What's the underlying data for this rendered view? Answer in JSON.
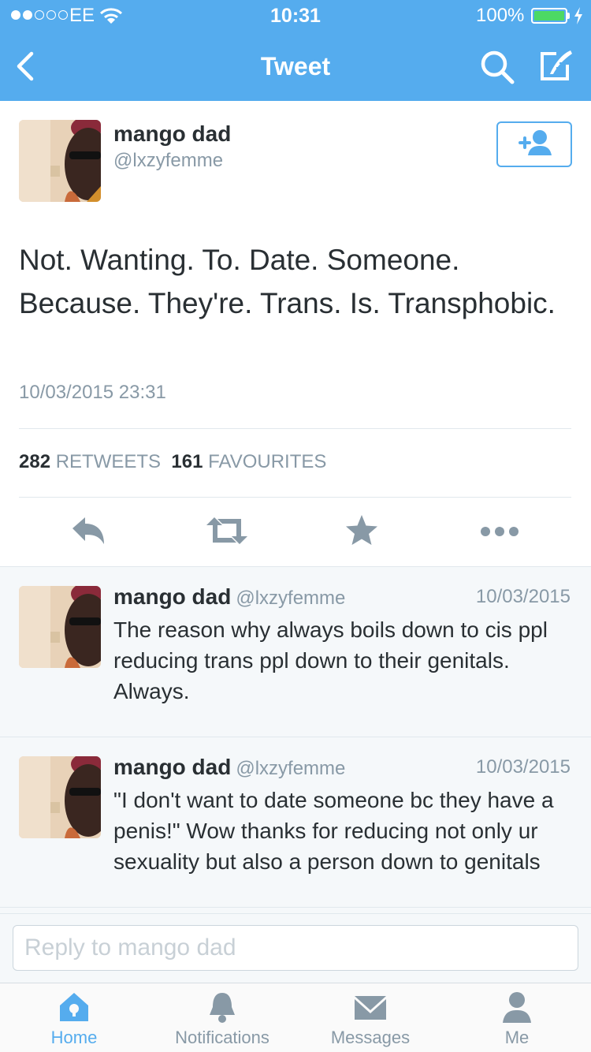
{
  "status_bar": {
    "carrier": "EE",
    "time": "10:31",
    "battery": "100%"
  },
  "nav": {
    "title": "Tweet"
  },
  "tweet": {
    "name": "mango dad",
    "handle": "@lxzyfemme",
    "text": "Not. Wanting. To. Date. Someone. Because. They're. Trans. Is. Transphobic.",
    "timestamp": "10/03/2015 23:31",
    "retweets_count": "282",
    "retweets_label": "RETWEETS",
    "favourites_count": "161",
    "favourites_label": "FAVOURITES"
  },
  "replies": [
    {
      "name": "mango dad",
      "handle": "@lxzyfemme",
      "date": "10/03/2015",
      "text": "The reason why always boils down to cis ppl reducing trans ppl down to their genitals. Always."
    },
    {
      "name": "mango dad",
      "handle": "@lxzyfemme",
      "date": "10/03/2015",
      "text": "\"I don't want to date someone bc they have a penis!\" Wow thanks for reducing not only ur sexuality but also a person down to genitals"
    }
  ],
  "reply_box": {
    "placeholder": "Reply to mango dad"
  },
  "tabs": [
    {
      "label": "Home",
      "icon": "home-icon",
      "active": true
    },
    {
      "label": "Notifications",
      "icon": "bell-icon",
      "active": false
    },
    {
      "label": "Messages",
      "icon": "envelope-icon",
      "active": false
    },
    {
      "label": "Me",
      "icon": "person-icon",
      "active": false
    }
  ],
  "colors": {
    "brand": "#55acee",
    "text": "#292f33",
    "muted": "#8899a6",
    "battery": "#4cd964"
  }
}
